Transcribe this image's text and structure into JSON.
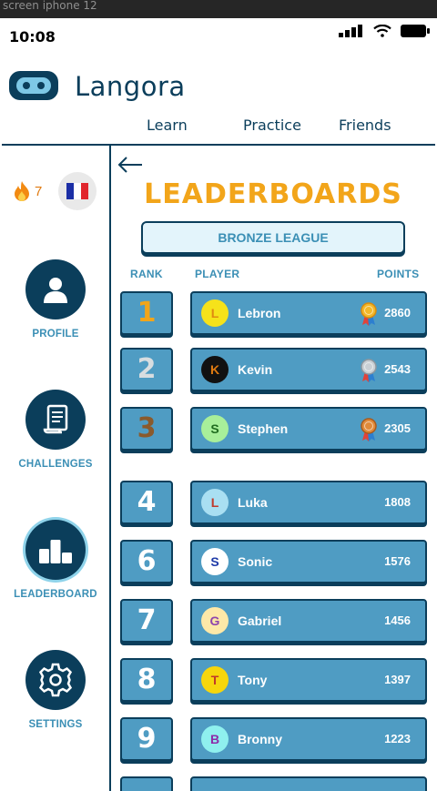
{
  "frame_title": "screen iphone 12",
  "status_bar": {
    "time": "10:08"
  },
  "app": {
    "brand": "Langora"
  },
  "nav": [
    "Learn",
    "Practice",
    "Friends"
  ],
  "sidebar": {
    "streak": "7",
    "items": [
      {
        "label": "PROFILE",
        "icon": "profile-icon"
      },
      {
        "label": "CHALLENGES",
        "icon": "scroll-icon"
      },
      {
        "label": "LEADERBOARD",
        "icon": "podium-icon",
        "active": true
      },
      {
        "label": "SETTINGS",
        "icon": "gear-icon"
      }
    ]
  },
  "leaderboard": {
    "title": "LEADERBOARDS",
    "league": "BRONZE LEAGUE",
    "headers": {
      "rank": "RANK",
      "player": "PLAYER",
      "points": "POINTS"
    },
    "rows": [
      {
        "rank": "1",
        "initial": "L",
        "name": "Lebron",
        "points": "2860",
        "medal": "gold",
        "avatar_bg": "#f6e21a",
        "avatar_fg": "#e08a10",
        "rank_color": "#f2a51a"
      },
      {
        "rank": "2",
        "initial": "K",
        "name": "Kevin",
        "points": "2543",
        "medal": "silver",
        "avatar_bg": "#111111",
        "avatar_fg": "#e07a10",
        "rank_color": "#d8dde0"
      },
      {
        "rank": "3",
        "initial": "S",
        "name": "Stephen",
        "points": "2305",
        "medal": "bronze",
        "avatar_bg": "#a8ef9a",
        "avatar_fg": "#1f6b1f",
        "rank_color": "#8a5a2c"
      },
      {
        "rank": "4",
        "initial": "L",
        "name": "Luka",
        "points": "1808",
        "avatar_bg": "#a9dff2",
        "avatar_fg": "#c0392b",
        "rank_color": "#ffffff"
      },
      {
        "rank": "6",
        "initial": "S",
        "name": "Sonic",
        "points": "1576",
        "avatar_bg": "#ffffff",
        "avatar_fg": "#1e3aa8",
        "rank_color": "#ffffff"
      },
      {
        "rank": "7",
        "initial": "G",
        "name": "Gabriel",
        "points": "1456",
        "avatar_bg": "#fde8a8",
        "avatar_fg": "#8e44ad",
        "rank_color": "#ffffff"
      },
      {
        "rank": "8",
        "initial": "T",
        "name": "Tony",
        "points": "1397",
        "avatar_bg": "#f6d60c",
        "avatar_fg": "#c0392b",
        "rank_color": "#ffffff"
      },
      {
        "rank": "9",
        "initial": "B",
        "name": "Bronny",
        "points": "1223",
        "avatar_bg": "#8ff0ee",
        "avatar_fg": "#8e2aa8",
        "rank_color": "#ffffff"
      }
    ]
  },
  "colors": {
    "navy": "#0b3e5b",
    "accent": "#3b8fb5",
    "row": "#4f9cc3",
    "title": "#f2a51a"
  }
}
